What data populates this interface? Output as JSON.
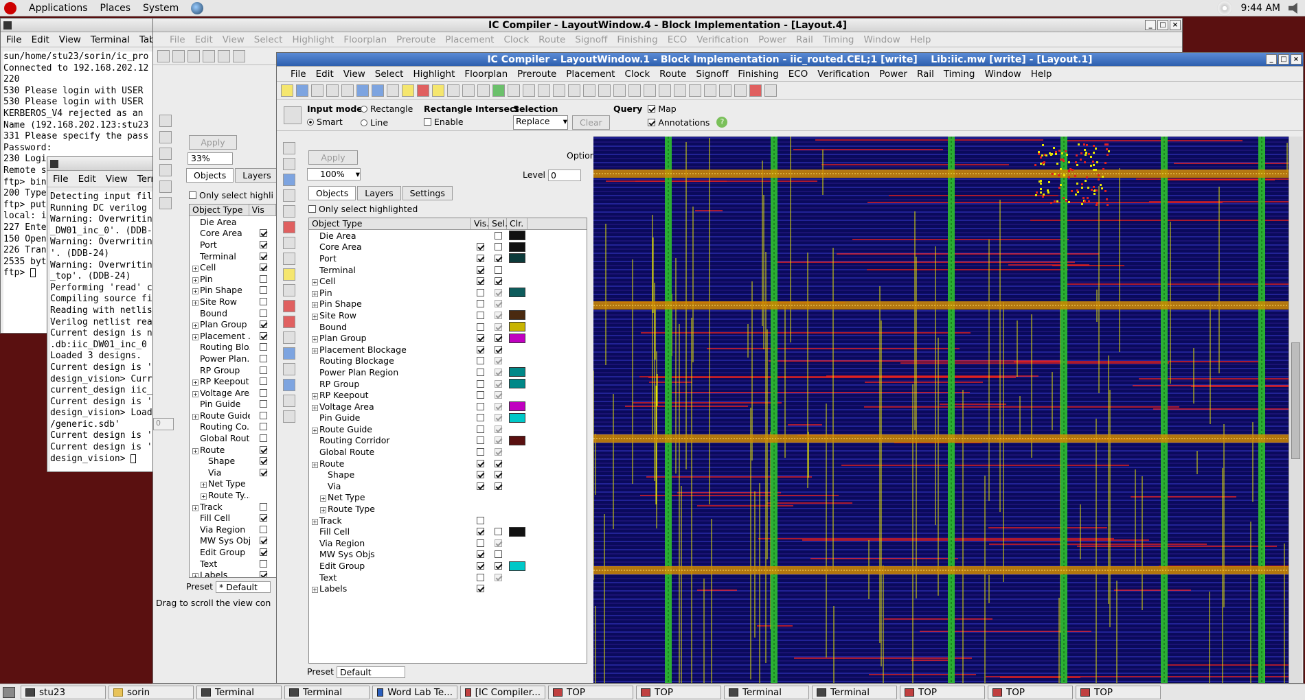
{
  "top_panel": {
    "menu": [
      "Applications",
      "Places",
      "System"
    ],
    "time": "9:44 AM"
  },
  "terminal_window": {
    "menu": [
      "File",
      "Edit",
      "View",
      "Terminal",
      "Tabs"
    ],
    "lines": [
      "sun/home/stu23/sorin/ic_pro",
      "Connected to 192.168.202.12",
      "220",
      "530 Please login with USER",
      "530 Please login with USER",
      "KERBEROS_V4 rejected as an",
      "Name (192.168.202.123:stu23",
      "331 Please specify the pass",
      "Password:",
      "230 Logi",
      "Remote s",
      "ftp> bin",
      "200 Type",
      "ftp> put",
      "local: i",
      "227 Ente",
      "150 Open",
      "226 Tran",
      "2535 byt",
      "ftp> "
    ]
  },
  "dc_terminal": {
    "menu": [
      "File",
      "Edit",
      "View",
      "Term"
    ],
    "lines": [
      "Detecting input fil",
      "Running DC verilog",
      "Warning: Overwritin",
      "_DW01_inc_0'. (DDB-",
      "Warning: Overwritin",
      "'. (DDB-24)",
      "Warning: Overwritin",
      "_top'. (DDB-24)",
      "Performing 'read' c",
      "Compiling source fi",
      "Reading with netlis",
      "Verilog netlist rea",
      "Current design is n",
      ".db:iic_DW01_inc_0",
      "Loaded 3 designs.",
      "Current design is '",
      "design_vision> Curr",
      "current_design iic_",
      "Current design is '",
      "design_vision> Load",
      "/generic.sdb'",
      "Current design is '",
      "Current design is '",
      "design_vision> "
    ]
  },
  "layout4": {
    "title": "IC Compiler - LayoutWindow.4 - Block Implementation - [Layout.4]",
    "menu": [
      "File",
      "Edit",
      "View",
      "Select",
      "Highlight",
      "Floorplan",
      "Preroute",
      "Placement",
      "Clock",
      "Route",
      "Signoff",
      "Finishing",
      "ECO",
      "Verification",
      "Power",
      "Rail",
      "Timing",
      "Window",
      "Help"
    ],
    "apply_label": "Apply",
    "zoom": "33%",
    "tabs": [
      "Objects",
      "Layers"
    ],
    "only_select_label": "Only select highli",
    "obj_header": [
      "Object Type",
      "Vis"
    ],
    "level_value": "0",
    "preset_label": "Preset",
    "preset_value": "Default",
    "status": "Drag to scroll the view con",
    "rows": [
      {
        "name": "Die Area",
        "indent": 0,
        "exp": false,
        "vis": "none"
      },
      {
        "name": "Core Area",
        "indent": 0,
        "exp": false,
        "vis": "on"
      },
      {
        "name": "Port",
        "indent": 0,
        "exp": false,
        "vis": "on"
      },
      {
        "name": "Terminal",
        "indent": 0,
        "exp": false,
        "vis": "on"
      },
      {
        "name": "Cell",
        "indent": 0,
        "exp": true,
        "vis": "on"
      },
      {
        "name": "Pin",
        "indent": 0,
        "exp": true,
        "vis": "off"
      },
      {
        "name": "Pin Shape",
        "indent": 0,
        "exp": true,
        "vis": "off"
      },
      {
        "name": "Site Row",
        "indent": 0,
        "exp": true,
        "vis": "off"
      },
      {
        "name": "Bound",
        "indent": 0,
        "exp": false,
        "vis": "off"
      },
      {
        "name": "Plan Group",
        "indent": 0,
        "exp": true,
        "vis": "on"
      },
      {
        "name": "Placement ...",
        "indent": 0,
        "exp": true,
        "vis": "on"
      },
      {
        "name": "Routing Blo...",
        "indent": 0,
        "exp": false,
        "vis": "off"
      },
      {
        "name": "Power Plan...",
        "indent": 0,
        "exp": false,
        "vis": "off"
      },
      {
        "name": "RP Group",
        "indent": 0,
        "exp": false,
        "vis": "off"
      },
      {
        "name": "RP Keepout",
        "indent": 0,
        "exp": true,
        "vis": "off"
      },
      {
        "name": "Voltage Area",
        "indent": 0,
        "exp": true,
        "vis": "off"
      },
      {
        "name": "Pin Guide",
        "indent": 0,
        "exp": false,
        "vis": "off"
      },
      {
        "name": "Route Guide",
        "indent": 0,
        "exp": true,
        "vis": "off"
      },
      {
        "name": "Routing Co...",
        "indent": 0,
        "exp": false,
        "vis": "off"
      },
      {
        "name": "Global Route",
        "indent": 0,
        "exp": false,
        "vis": "off"
      },
      {
        "name": "Route",
        "indent": 0,
        "exp": true,
        "vis": "on"
      },
      {
        "name": "Shape",
        "indent": 1,
        "exp": false,
        "vis": "on"
      },
      {
        "name": "Via",
        "indent": 1,
        "exp": false,
        "vis": "on"
      },
      {
        "name": "Net Type",
        "indent": 1,
        "exp": true,
        "vis": "none"
      },
      {
        "name": "Route Ty...",
        "indent": 1,
        "exp": true,
        "vis": "none"
      },
      {
        "name": "Track",
        "indent": 0,
        "exp": true,
        "vis": "off"
      },
      {
        "name": "Fill Cell",
        "indent": 0,
        "exp": false,
        "vis": "on"
      },
      {
        "name": "Via Region",
        "indent": 0,
        "exp": false,
        "vis": "off"
      },
      {
        "name": "MW Sys Objs",
        "indent": 0,
        "exp": false,
        "vis": "on"
      },
      {
        "name": "Edit Group",
        "indent": 0,
        "exp": false,
        "vis": "on"
      },
      {
        "name": "Text",
        "indent": 0,
        "exp": false,
        "vis": "off"
      },
      {
        "name": "Labels",
        "indent": 0,
        "exp": true,
        "vis": "on"
      }
    ]
  },
  "layout1": {
    "title": "IC Compiler - LayoutWindow.1 - Block Implementation - iic_routed.CEL;1 [write]    Lib:iic.mw [write] - [Layout.1]",
    "menu": [
      "File",
      "Edit",
      "View",
      "Select",
      "Highlight",
      "Floorplan",
      "Preroute",
      "Placement",
      "Clock",
      "Route",
      "Signoff",
      "Finishing",
      "ECO",
      "Verification",
      "Power",
      "Rail",
      "Timing",
      "Window",
      "Help"
    ],
    "input_mode": {
      "label": "Input mode",
      "options": [
        "Rectangle",
        "Smart",
        "Line"
      ],
      "selected": "Smart"
    },
    "rect_intersect": {
      "label": "Rectangle Intersect",
      "enable_label": "Enable"
    },
    "selection": {
      "label": "Selection",
      "value": "Replace",
      "clear_label": "Clear"
    },
    "query": {
      "label": "Query",
      "map_label": "Map",
      "annotations_label": "Annotations"
    },
    "apply_label": "Apply",
    "options_label": "Options:",
    "zoom": "100%",
    "level_label": "Level",
    "level_value": "0",
    "tabs": [
      "Objects",
      "Layers",
      "Settings"
    ],
    "only_select_label": "Only select highlighted",
    "obj_header": [
      "Object Type",
      "Vis.",
      "Sel.",
      "Clr."
    ],
    "preset_label": "Preset",
    "preset_value": "Default",
    "rows": [
      {
        "name": "Die Area",
        "indent": 0,
        "exp": false,
        "vis": "none",
        "sel": "off",
        "clr": "#111111"
      },
      {
        "name": "Core Area",
        "indent": 0,
        "exp": false,
        "vis": "on",
        "sel": "off",
        "clr": "#111111"
      },
      {
        "name": "Port",
        "indent": 0,
        "exp": false,
        "vis": "on",
        "sel": "on",
        "clr": "#0c3a3a"
      },
      {
        "name": "Terminal",
        "indent": 0,
        "exp": false,
        "vis": "on",
        "sel": "off",
        "clr": ""
      },
      {
        "name": "Cell",
        "indent": 0,
        "exp": true,
        "vis": "on",
        "sel": "on",
        "clr": ""
      },
      {
        "name": "Pin",
        "indent": 0,
        "exp": true,
        "vis": "off",
        "sel": "gray",
        "clr": "#0e5c5c"
      },
      {
        "name": "Pin Shape",
        "indent": 0,
        "exp": true,
        "vis": "off",
        "sel": "gray",
        "clr": ""
      },
      {
        "name": "Site Row",
        "indent": 0,
        "exp": true,
        "vis": "off",
        "sel": "gray",
        "clr": "#4a2a10"
      },
      {
        "name": "Bound",
        "indent": 0,
        "exp": false,
        "vis": "off",
        "sel": "gray",
        "clr": "#c8b400"
      },
      {
        "name": "Plan Group",
        "indent": 0,
        "exp": true,
        "vis": "on",
        "sel": "on",
        "clr": "#c000c0"
      },
      {
        "name": "Placement Blockage",
        "indent": 0,
        "exp": true,
        "vis": "on",
        "sel": "on",
        "clr": ""
      },
      {
        "name": "Routing Blockage",
        "indent": 0,
        "exp": false,
        "vis": "off",
        "sel": "gray",
        "clr": ""
      },
      {
        "name": "Power Plan Region",
        "indent": 0,
        "exp": false,
        "vis": "off",
        "sel": "gray",
        "clr": "#008888"
      },
      {
        "name": "RP Group",
        "indent": 0,
        "exp": false,
        "vis": "off",
        "sel": "gray",
        "clr": "#008888"
      },
      {
        "name": "RP Keepout",
        "indent": 0,
        "exp": true,
        "vis": "off",
        "sel": "gray",
        "clr": ""
      },
      {
        "name": "Voltage Area",
        "indent": 0,
        "exp": true,
        "vis": "off",
        "sel": "gray",
        "clr": "#c000c0"
      },
      {
        "name": "Pin Guide",
        "indent": 0,
        "exp": false,
        "vis": "off",
        "sel": "gray",
        "clr": "#00c8c8"
      },
      {
        "name": "Route Guide",
        "indent": 0,
        "exp": true,
        "vis": "off",
        "sel": "gray",
        "clr": ""
      },
      {
        "name": "Routing Corridor",
        "indent": 0,
        "exp": false,
        "vis": "off",
        "sel": "gray",
        "clr": "#5a1010"
      },
      {
        "name": "Global Route",
        "indent": 0,
        "exp": false,
        "vis": "off",
        "sel": "gray",
        "clr": ""
      },
      {
        "name": "Route",
        "indent": 0,
        "exp": true,
        "vis": "on",
        "sel": "on",
        "clr": ""
      },
      {
        "name": "Shape",
        "indent": 1,
        "exp": false,
        "vis": "on",
        "sel": "on",
        "clr": ""
      },
      {
        "name": "Via",
        "indent": 1,
        "exp": false,
        "vis": "on",
        "sel": "on",
        "clr": ""
      },
      {
        "name": "Net Type",
        "indent": 1,
        "exp": true,
        "vis": "none",
        "sel": "none",
        "clr": ""
      },
      {
        "name": "Route Type",
        "indent": 1,
        "exp": true,
        "vis": "none",
        "sel": "none",
        "clr": ""
      },
      {
        "name": "Track",
        "indent": 0,
        "exp": true,
        "vis": "off",
        "sel": "none",
        "clr": ""
      },
      {
        "name": "Fill Cell",
        "indent": 0,
        "exp": false,
        "vis": "on",
        "sel": "off",
        "clr": "#111111"
      },
      {
        "name": "Via Region",
        "indent": 0,
        "exp": false,
        "vis": "off",
        "sel": "gray",
        "clr": ""
      },
      {
        "name": "MW Sys Objs",
        "indent": 0,
        "exp": false,
        "vis": "on",
        "sel": "off",
        "clr": ""
      },
      {
        "name": "Edit Group",
        "indent": 0,
        "exp": false,
        "vis": "on",
        "sel": "on",
        "clr": "#00c8c8"
      },
      {
        "name": "Text",
        "indent": 0,
        "exp": false,
        "vis": "off",
        "sel": "gray",
        "clr": ""
      },
      {
        "name": "Labels",
        "indent": 0,
        "exp": true,
        "vis": "on",
        "sel": "none",
        "clr": ""
      }
    ]
  },
  "taskbar": [
    {
      "label": "stu23",
      "icon": "terminal-icon"
    },
    {
      "label": "sorin",
      "icon": "folder-icon"
    },
    {
      "label": "Terminal",
      "icon": "terminal-icon"
    },
    {
      "label": "Terminal",
      "icon": "terminal-icon"
    },
    {
      "label": "Word Lab Te...",
      "icon": "word-icon"
    },
    {
      "label": "[IC Compiler...",
      "icon": "ic-compiler-icon"
    },
    {
      "label": "TOP",
      "icon": "ic-compiler-icon"
    },
    {
      "label": "TOP",
      "icon": "ic-compiler-icon"
    },
    {
      "label": "Terminal",
      "icon": "terminal-icon"
    },
    {
      "label": "Terminal",
      "icon": "terminal-icon"
    },
    {
      "label": "TOP",
      "icon": "ic-compiler-icon"
    },
    {
      "label": "TOP",
      "icon": "ic-compiler-icon"
    },
    {
      "label": "TOP",
      "icon": "ic-compiler-icon"
    }
  ],
  "colors": {
    "canvas_bg": "#0a0a5c",
    "power_strap": "#2ec02e",
    "route_yellow": "#e6e600",
    "route_red": "#e02020",
    "route_orange": "#d08a00"
  }
}
